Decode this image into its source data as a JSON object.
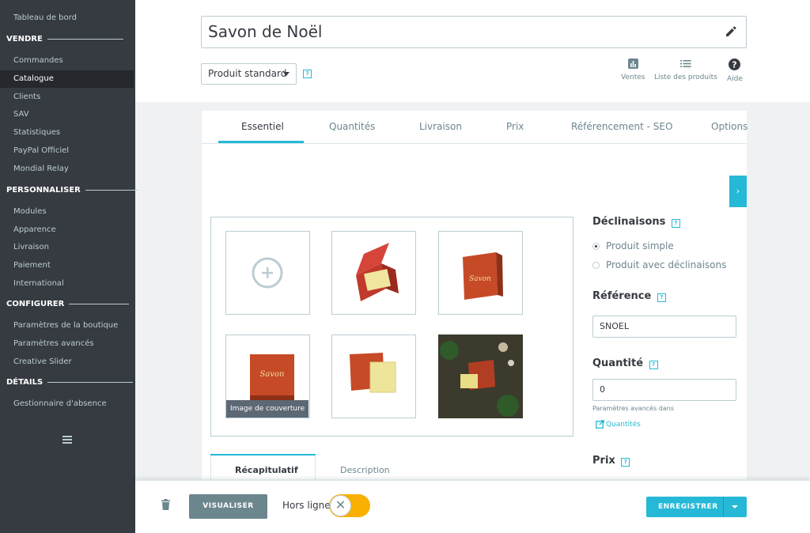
{
  "sidebar": {
    "dashboard": "Tableau de bord",
    "sections": [
      {
        "title": "VENDRE",
        "items": [
          "Commandes",
          "Catalogue",
          "Clients",
          "SAV",
          "Statistiques",
          "PayPal Officiel",
          "Mondial Relay"
        ]
      },
      {
        "title": "PERSONNALISER",
        "items": [
          "Modules",
          "Apparence",
          "Livraison",
          "Paiement",
          "International"
        ]
      },
      {
        "title": "CONFIGURER",
        "items": [
          "Paramètres de la boutique",
          "Paramètres avancés",
          "Creative Slider"
        ]
      },
      {
        "title": "DÉTAILS",
        "items": [
          "Gestionnaire d'absence"
        ]
      }
    ],
    "active_item": "Catalogue",
    "menu_icon": "hamburger-icon"
  },
  "header": {
    "product_name": "Savon de Noël",
    "edit_icon": "pencil-icon",
    "product_type": "Produit standard",
    "help_mark": "?",
    "tools": [
      {
        "label": "Ventes",
        "icon": "bar-chart-icon"
      },
      {
        "label": "Liste des produits",
        "icon": "list-icon"
      },
      {
        "label": "Aide",
        "icon": "help-circle-icon"
      }
    ]
  },
  "tabs": {
    "items": [
      "Essentiel",
      "Quantités",
      "Livraison",
      "Prix",
      "Référencement - SEO",
      "Options"
    ],
    "active": "Essentiel"
  },
  "gallery": {
    "add_icon": "plus-circle-icon",
    "cover_label": "Image de couverture"
  },
  "right_panel": {
    "declinaisons_title": "Déclinaisons",
    "option_simple": "Produit simple",
    "option_variants": "Produit avec déclinaisons",
    "selected_option": "Produit simple",
    "reference_title": "Référence",
    "reference_value": "SNOEL",
    "quantity_title": "Quantité",
    "quantity_value": "0",
    "advanced_note": "Paramètres avancés dans",
    "quantities_link": "Quantités",
    "price_title": "Prix"
  },
  "subtabs": {
    "items": [
      "Récapitulatif",
      "Description"
    ],
    "active": "Récapitulatif"
  },
  "footer": {
    "preview_label": "VISUALISER",
    "offline_label": "Hors ligne",
    "toggle_state": "off",
    "save_label": "ENREGISTRER",
    "delete_icon": "trash-icon"
  },
  "colors": {
    "sidebar_bg": "#363a41",
    "accent": "#25b9d7",
    "toggle": "#fab000",
    "muted_button": "#6c868e"
  }
}
